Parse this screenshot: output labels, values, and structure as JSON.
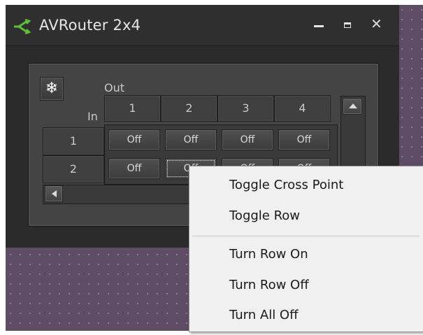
{
  "window": {
    "title": "AVRouter 2x4",
    "controls": {
      "minimize_icon": "minimize-icon",
      "maximize_icon": "maximize-icon",
      "close_glyph": "✕"
    }
  },
  "router": {
    "settings_glyph": "❄",
    "out_label": "Out",
    "in_label": "In",
    "columns": [
      "1",
      "2",
      "3",
      "4"
    ],
    "rows": [
      {
        "label": "1",
        "cells": [
          "Off",
          "Off",
          "Off",
          "Off"
        ]
      },
      {
        "label": "2",
        "cells": [
          "Off",
          "Off",
          "Off",
          "Off"
        ]
      }
    ]
  },
  "context_menu": {
    "items": [
      "Toggle Cross Point",
      "Toggle Row",
      "Turn Row On",
      "Turn Row Off",
      "Turn All Off"
    ]
  },
  "colors": {
    "accent_icon": "#5fbf3a",
    "canvas": "#5e4b64",
    "window": "#2b2b2b",
    "menu": "#f0f0f0"
  }
}
